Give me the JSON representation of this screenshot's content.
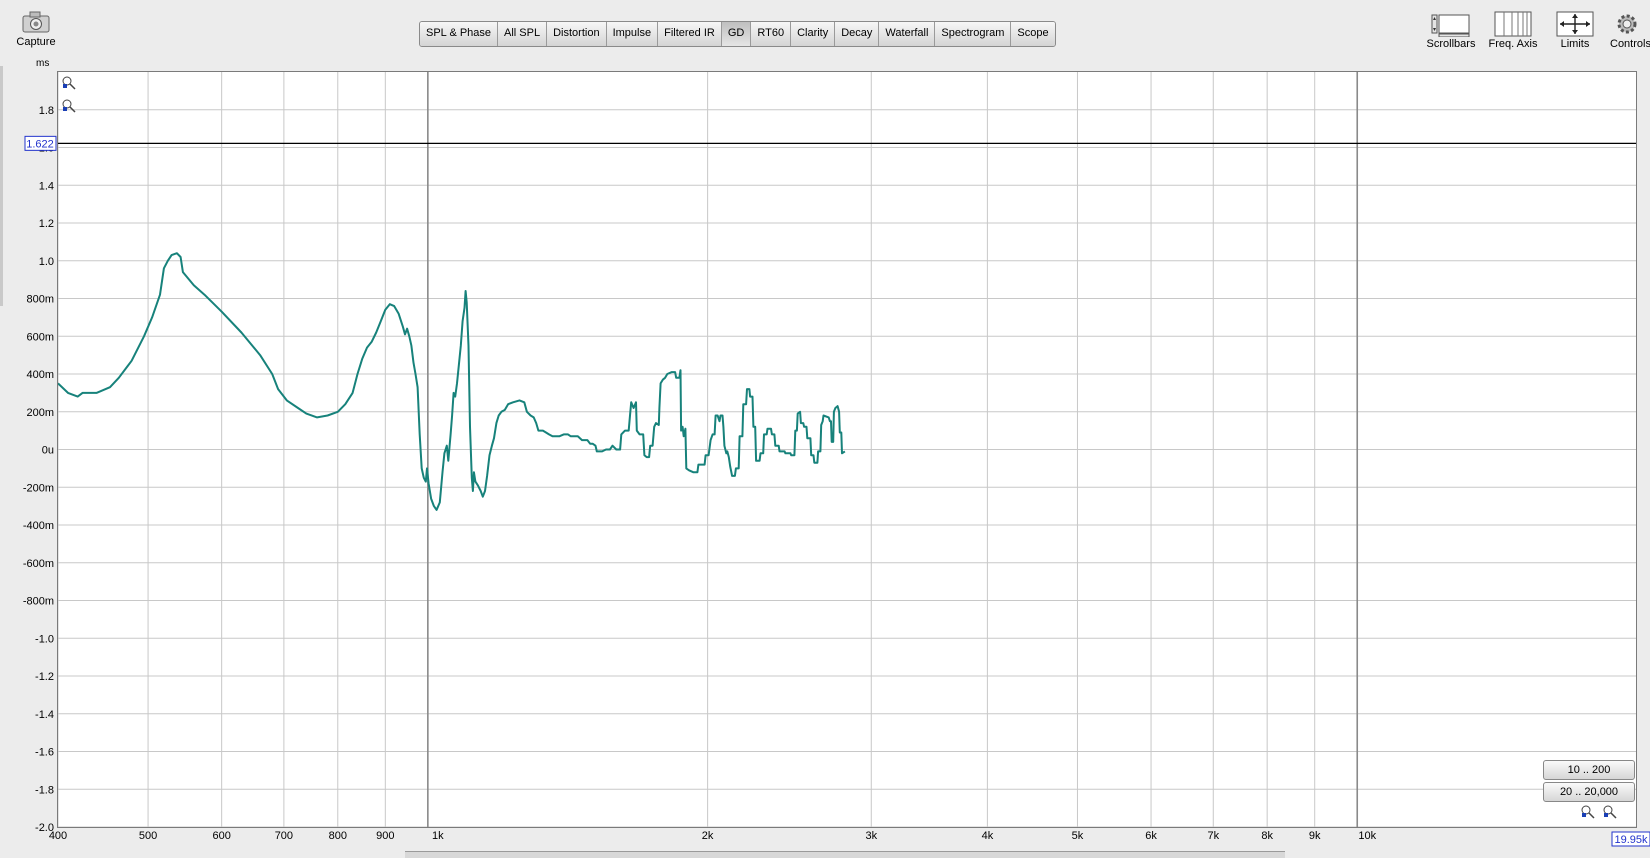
{
  "toolbar": {
    "capture_label": "Capture",
    "units_label": "ms",
    "tabs": [
      {
        "label": "SPL & Phase",
        "active": false
      },
      {
        "label": "All SPL",
        "active": false
      },
      {
        "label": "Distortion",
        "active": false
      },
      {
        "label": "Impulse",
        "active": false
      },
      {
        "label": "Filtered IR",
        "active": false
      },
      {
        "label": "GD",
        "active": true
      },
      {
        "label": "RT60",
        "active": false
      },
      {
        "label": "Clarity",
        "active": false
      },
      {
        "label": "Decay",
        "active": false
      },
      {
        "label": "Waterfall",
        "active": false
      },
      {
        "label": "Spectrogram",
        "active": false
      },
      {
        "label": "Scope",
        "active": false
      }
    ],
    "tools": [
      {
        "label": "Scrollbars",
        "icon": "scrollbars-icon"
      },
      {
        "label": "Freq. Axis",
        "icon": "freq-axis-icon"
      },
      {
        "label": "Limits",
        "icon": "limits-icon"
      },
      {
        "label": "Controls",
        "icon": "gear-icon"
      }
    ]
  },
  "range_buttons": {
    "low": "10 .. 200",
    "full": "20 .. 20,000"
  },
  "cursor": {
    "y_value": "1.622",
    "x_value": "19.95k"
  },
  "colors": {
    "trace": "#17827b",
    "grid": "#c8c8c8",
    "cursor": "#2233cc"
  },
  "chart_data": {
    "type": "line",
    "x_scale": "log",
    "xlim": [
      400,
      19950
    ],
    "ylim": [
      -2.0,
      2.0
    ],
    "y_ticks": [
      {
        "v": 1.8,
        "label": "1.8"
      },
      {
        "v": 1.6,
        "label": "1.6"
      },
      {
        "v": 1.4,
        "label": "1.4"
      },
      {
        "v": 1.2,
        "label": "1.2"
      },
      {
        "v": 1.0,
        "label": "1.0"
      },
      {
        "v": 0.8,
        "label": "800m"
      },
      {
        "v": 0.6,
        "label": "600m"
      },
      {
        "v": 0.4,
        "label": "400m"
      },
      {
        "v": 0.2,
        "label": "200m"
      },
      {
        "v": 0.0,
        "label": "0u"
      },
      {
        "v": -0.2,
        "label": "-200m"
      },
      {
        "v": -0.4,
        "label": "-400m"
      },
      {
        "v": -0.6,
        "label": "-600m"
      },
      {
        "v": -0.8,
        "label": "-800m"
      },
      {
        "v": -1.0,
        "label": "-1.0"
      },
      {
        "v": -1.2,
        "label": "-1.2"
      },
      {
        "v": -1.4,
        "label": "-1.4"
      },
      {
        "v": -1.6,
        "label": "-1.6"
      },
      {
        "v": -1.8,
        "label": "-1.8"
      },
      {
        "v": -2.0,
        "label": "-2.0"
      }
    ],
    "x_ticks": [
      {
        "v": 400,
        "label": "400"
      },
      {
        "v": 500,
        "label": "500"
      },
      {
        "v": 600,
        "label": "600"
      },
      {
        "v": 700,
        "label": "700"
      },
      {
        "v": 800,
        "label": "800"
      },
      {
        "v": 900,
        "label": "900"
      },
      {
        "v": 1000,
        "label": "1k",
        "major": true
      },
      {
        "v": 2000,
        "label": "2k"
      },
      {
        "v": 3000,
        "label": "3k"
      },
      {
        "v": 4000,
        "label": "4k"
      },
      {
        "v": 5000,
        "label": "5k"
      },
      {
        "v": 6000,
        "label": "6k"
      },
      {
        "v": 7000,
        "label": "7k"
      },
      {
        "v": 8000,
        "label": "8k"
      },
      {
        "v": 9000,
        "label": "9k"
      },
      {
        "v": 10000,
        "label": "10k",
        "major": true
      }
    ],
    "cursor_y": 1.622,
    "series": [
      {
        "points": [
          [
            400,
            0.35
          ],
          [
            410,
            0.3
          ],
          [
            420,
            0.28
          ],
          [
            425,
            0.3
          ],
          [
            440,
            0.3
          ],
          [
            455,
            0.33
          ],
          [
            465,
            0.38
          ],
          [
            480,
            0.47
          ],
          [
            495,
            0.6
          ],
          [
            505,
            0.7
          ],
          [
            515,
            0.82
          ],
          [
            520,
            0.96
          ],
          [
            525,
            1.0
          ],
          [
            530,
            1.03
          ],
          [
            537,
            1.04
          ],
          [
            542,
            1.02
          ],
          [
            545,
            0.94
          ],
          [
            560,
            0.87
          ],
          [
            575,
            0.82
          ],
          [
            600,
            0.73
          ],
          [
            630,
            0.62
          ],
          [
            660,
            0.5
          ],
          [
            680,
            0.4
          ],
          [
            690,
            0.32
          ],
          [
            705,
            0.26
          ],
          [
            725,
            0.22
          ],
          [
            740,
            0.19
          ],
          [
            760,
            0.17
          ],
          [
            780,
            0.18
          ],
          [
            800,
            0.2
          ],
          [
            815,
            0.24
          ],
          [
            830,
            0.3
          ],
          [
            840,
            0.4
          ],
          [
            850,
            0.48
          ],
          [
            860,
            0.54
          ],
          [
            870,
            0.57
          ],
          [
            880,
            0.62
          ],
          [
            890,
            0.68
          ],
          [
            900,
            0.74
          ],
          [
            910,
            0.77
          ],
          [
            920,
            0.76
          ],
          [
            930,
            0.72
          ],
          [
            940,
            0.65
          ],
          [
            945,
            0.61
          ],
          [
            950,
            0.64
          ],
          [
            955,
            0.6
          ],
          [
            960,
            0.55
          ],
          [
            965,
            0.46
          ],
          [
            970,
            0.4
          ],
          [
            975,
            0.33
          ],
          [
            980,
            0.08
          ],
          [
            985,
            -0.1
          ],
          [
            990,
            -0.15
          ],
          [
            995,
            -0.17
          ],
          [
            998,
            -0.1
          ],
          [
            1002,
            -0.18
          ],
          [
            1008,
            -0.26
          ],
          [
            1015,
            -0.3
          ],
          [
            1022,
            -0.32
          ],
          [
            1030,
            -0.28
          ],
          [
            1037,
            -0.12
          ],
          [
            1042,
            -0.02
          ],
          [
            1048,
            0.02
          ],
          [
            1052,
            -0.06
          ],
          [
            1058,
            0.08
          ],
          [
            1062,
            0.18
          ],
          [
            1066,
            0.3
          ],
          [
            1070,
            0.28
          ],
          [
            1075,
            0.35
          ],
          [
            1080,
            0.45
          ],
          [
            1085,
            0.55
          ],
          [
            1090,
            0.68
          ],
          [
            1095,
            0.75
          ],
          [
            1098,
            0.84
          ],
          [
            1101,
            0.78
          ],
          [
            1106,
            0.55
          ],
          [
            1110,
            0.12
          ],
          [
            1115,
            -0.15
          ],
          [
            1118,
            -0.22
          ],
          [
            1121,
            -0.12
          ],
          [
            1125,
            -0.17
          ],
          [
            1132,
            -0.19
          ],
          [
            1140,
            -0.22
          ],
          [
            1146,
            -0.25
          ],
          [
            1152,
            -0.22
          ],
          [
            1158,
            -0.14
          ],
          [
            1165,
            -0.03
          ],
          [
            1172,
            0.02
          ],
          [
            1178,
            0.06
          ],
          [
            1185,
            0.14
          ],
          [
            1192,
            0.18
          ],
          [
            1200,
            0.2
          ],
          [
            1210,
            0.21
          ],
          [
            1220,
            0.24
          ],
          [
            1235,
            0.25
          ],
          [
            1255,
            0.26
          ],
          [
            1270,
            0.25
          ],
          [
            1278,
            0.2
          ],
          [
            1290,
            0.18
          ],
          [
            1300,
            0.17
          ],
          [
            1308,
            0.14
          ],
          [
            1315,
            0.1
          ],
          [
            1330,
            0.1
          ],
          [
            1340,
            0.09
          ],
          [
            1350,
            0.08
          ],
          [
            1362,
            0.07
          ],
          [
            1385,
            0.07
          ],
          [
            1400,
            0.08
          ],
          [
            1415,
            0.08
          ],
          [
            1425,
            0.07
          ],
          [
            1450,
            0.07
          ],
          [
            1465,
            0.05
          ],
          [
            1485,
            0.05
          ],
          [
            1495,
            0.03
          ],
          [
            1505,
            0.03
          ],
          [
            1515,
            0.02
          ],
          [
            1520,
            -0.01
          ],
          [
            1540,
            -0.01
          ],
          [
            1555,
            0.0
          ],
          [
            1570,
            0.0
          ],
          [
            1580,
            0.02
          ],
          [
            1595,
            0.0
          ],
          [
            1610,
            0.0
          ],
          [
            1615,
            0.08
          ],
          [
            1630,
            0.1
          ],
          [
            1645,
            0.1
          ],
          [
            1650,
            0.18
          ],
          [
            1655,
            0.25
          ],
          [
            1665,
            0.22
          ],
          [
            1675,
            0.25
          ],
          [
            1678,
            0.1
          ],
          [
            1690,
            0.08
          ],
          [
            1705,
            0.08
          ],
          [
            1710,
            -0.03
          ],
          [
            1720,
            -0.04
          ],
          [
            1730,
            -0.04
          ],
          [
            1735,
            0.02
          ],
          [
            1745,
            0.02
          ],
          [
            1752,
            0.12
          ],
          [
            1760,
            0.14
          ],
          [
            1772,
            0.13
          ],
          [
            1775,
            0.22
          ],
          [
            1780,
            0.35
          ],
          [
            1790,
            0.37
          ],
          [
            1800,
            0.38
          ],
          [
            1810,
            0.4
          ],
          [
            1830,
            0.41
          ],
          [
            1845,
            0.41
          ],
          [
            1850,
            0.38
          ],
          [
            1865,
            0.38
          ],
          [
            1870,
            0.42
          ],
          [
            1873,
            0.1
          ],
          [
            1880,
            0.12
          ],
          [
            1885,
            0.07
          ],
          [
            1893,
            0.11
          ],
          [
            1897,
            -0.1
          ],
          [
            1910,
            -0.11
          ],
          [
            1930,
            -0.12
          ],
          [
            1950,
            -0.12
          ],
          [
            1955,
            -0.08
          ],
          [
            1970,
            -0.08
          ],
          [
            1985,
            -0.08
          ],
          [
            1990,
            -0.03
          ],
          [
            2005,
            -0.03
          ],
          [
            2015,
            0.05
          ],
          [
            2025,
            0.08
          ],
          [
            2035,
            0.08
          ],
          [
            2040,
            0.18
          ],
          [
            2050,
            0.18
          ],
          [
            2060,
            0.15
          ],
          [
            2065,
            0.18
          ],
          [
            2075,
            0.18
          ],
          [
            2080,
            0.12
          ],
          [
            2085,
            0.02
          ],
          [
            2095,
            -0.02
          ],
          [
            2100,
            -0.01
          ],
          [
            2108,
            -0.04
          ],
          [
            2115,
            -0.09
          ],
          [
            2125,
            -0.14
          ],
          [
            2140,
            -0.14
          ],
          [
            2145,
            -0.1
          ],
          [
            2160,
            -0.1
          ],
          [
            2165,
            0.07
          ],
          [
            2180,
            0.07
          ],
          [
            2185,
            0.24
          ],
          [
            2200,
            0.24
          ],
          [
            2205,
            0.32
          ],
          [
            2218,
            0.32
          ],
          [
            2222,
            0.28
          ],
          [
            2235,
            0.28
          ],
          [
            2240,
            0.12
          ],
          [
            2250,
            0.12
          ],
          [
            2255,
            -0.06
          ],
          [
            2275,
            -0.06
          ],
          [
            2280,
            -0.02
          ],
          [
            2295,
            -0.02
          ],
          [
            2300,
            0.08
          ],
          [
            2315,
            0.08
          ],
          [
            2320,
            0.11
          ],
          [
            2340,
            0.11
          ],
          [
            2345,
            0.08
          ],
          [
            2360,
            0.08
          ],
          [
            2365,
            0.02
          ],
          [
            2385,
            0.02
          ],
          [
            2390,
            -0.01
          ],
          [
            2420,
            -0.01
          ],
          [
            2425,
            -0.02
          ],
          [
            2455,
            -0.02
          ],
          [
            2460,
            -0.03
          ],
          [
            2480,
            -0.03
          ],
          [
            2485,
            0.1
          ],
          [
            2495,
            0.1
          ],
          [
            2500,
            0.19
          ],
          [
            2515,
            0.2
          ],
          [
            2520,
            0.14
          ],
          [
            2535,
            0.14
          ],
          [
            2540,
            0.12
          ],
          [
            2555,
            0.12
          ],
          [
            2560,
            0.06
          ],
          [
            2580,
            0.06
          ],
          [
            2585,
            -0.03
          ],
          [
            2600,
            -0.03
          ],
          [
            2605,
            -0.07
          ],
          [
            2625,
            -0.07
          ],
          [
            2630,
            -0.01
          ],
          [
            2645,
            -0.01
          ],
          [
            2650,
            0.13
          ],
          [
            2660,
            0.15
          ],
          [
            2665,
            0.18
          ],
          [
            2700,
            0.17
          ],
          [
            2708,
            0.15
          ],
          [
            2715,
            0.15
          ],
          [
            2720,
            0.04
          ],
          [
            2730,
            0.04
          ],
          [
            2735,
            0.2
          ],
          [
            2745,
            0.22
          ],
          [
            2760,
            0.23
          ],
          [
            2770,
            0.2
          ],
          [
            2775,
            0.09
          ],
          [
            2785,
            0.09
          ],
          [
            2790,
            -0.02
          ],
          [
            2810,
            -0.01
          ]
        ]
      }
    ]
  }
}
